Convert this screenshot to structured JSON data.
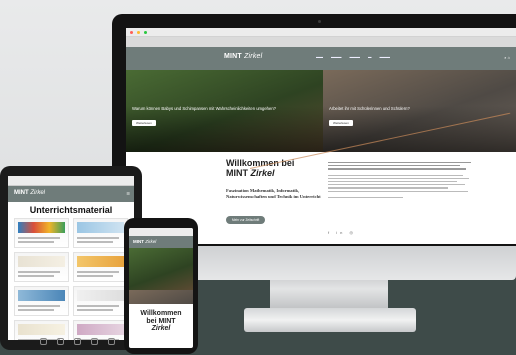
{
  "imac": {
    "site": {
      "logo_main": "MINT",
      "logo_italic": "Zirkel",
      "hero": [
        {
          "title": "Warum können Babys und Schimpansen mit Wahrscheinlichkeiten umgehen?",
          "button": "Weiterlesen"
        },
        {
          "title": "Arbeitet ihr mit Schülerinnen und Schülern?",
          "button": "Weiterlesen"
        }
      ],
      "welcome_line1": "Willkommen bei",
      "welcome_line2_main": "MINT",
      "welcome_line2_italic": "Zirkel",
      "subtitle": "Faszination Mathematik, Informatik, Naturwissenschaften und Technik im Unterricht",
      "cta": "Mehr zur Zeitschrift",
      "socials": "f in ◎"
    }
  },
  "tablet": {
    "logo_main": "MINT",
    "logo_italic": "Zirkel",
    "title": "Unterrichtsmaterial"
  },
  "phone": {
    "logo_main": "MINT",
    "logo_italic": "Zirkel",
    "welcome_line1": "Willkommen",
    "welcome_line2": "bei MINT",
    "welcome_line3": "Zirkel"
  },
  "colors": {
    "accent": "#6f7c7a",
    "band": "#3e4b49",
    "orange": "#d27a2b"
  }
}
